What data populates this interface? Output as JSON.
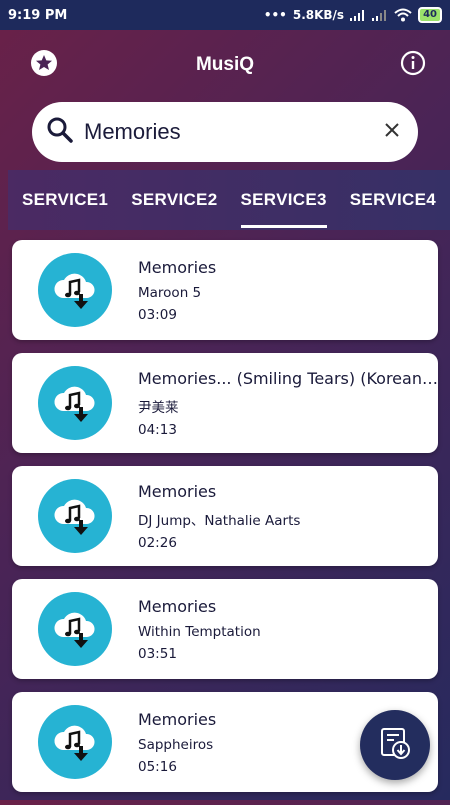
{
  "status_bar": {
    "time": "9:19 PM",
    "network_speed": "5.8KB/s",
    "battery": "40"
  },
  "app": {
    "title": "MusiQ",
    "left_icon": "star-icon",
    "right_icon": "info-icon"
  },
  "search": {
    "value": "Memories",
    "placeholder": ""
  },
  "tabs": [
    {
      "label": "SERVICE1",
      "active": false
    },
    {
      "label": "SERVICE2",
      "active": false
    },
    {
      "label": "SERVICE3",
      "active": true
    },
    {
      "label": "SERVICE4",
      "active": false
    }
  ],
  "results": [
    {
      "title": "Memories",
      "artist": "Maroon 5",
      "duration": "03:09"
    },
    {
      "title": "Memories... (Smiling Tears) (Korean Ver.)",
      "artist": "尹美莱",
      "duration": "04:13"
    },
    {
      "title": "Memories",
      "artist": "DJ Jump、Nathalie Aarts",
      "duration": "02:26"
    },
    {
      "title": "Memories",
      "artist": "Within Temptation",
      "duration": "03:51"
    },
    {
      "title": "Memories",
      "artist": "Sappheiros",
      "duration": "05:16"
    }
  ],
  "colors": {
    "accent_thumb": "#26b3d3",
    "fab": "#232d5e",
    "status_bar": "#1e2a5c"
  },
  "fab_icon": "downloads-list-icon"
}
